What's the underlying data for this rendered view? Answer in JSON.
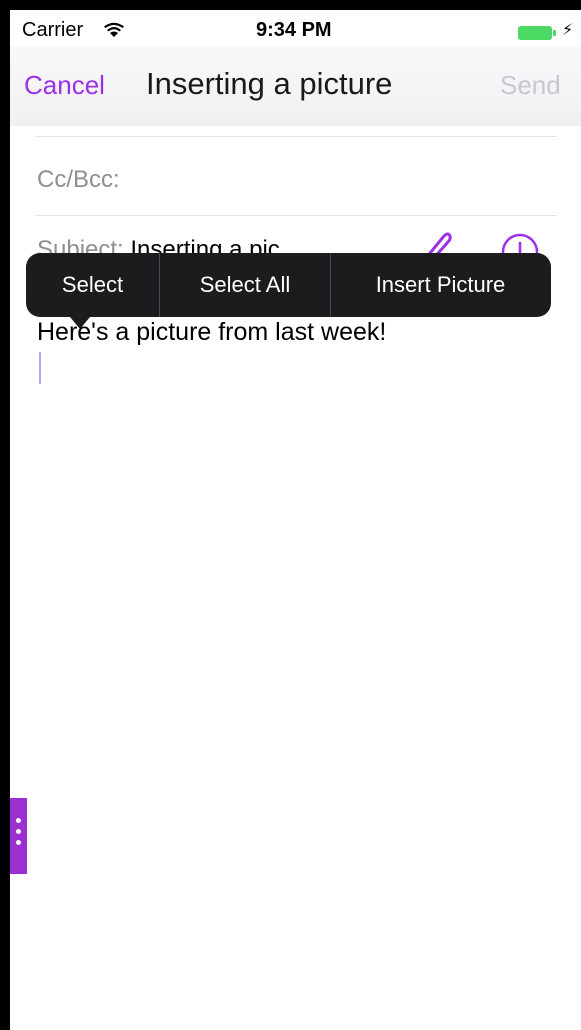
{
  "status_bar": {
    "carrier": "Carrier",
    "time": "9:34 PM",
    "wifi_icon": "wifi-icon",
    "battery_icon": "battery-icon",
    "charging_icon": "charging-bolt-icon"
  },
  "nav": {
    "cancel_label": "Cancel",
    "title": "Inserting a picture",
    "send_label": "Send",
    "accent_color": "#9b30e8",
    "disabled_color": "#c8c8cc"
  },
  "fields": {
    "cc_bcc_label": "Cc/Bcc:",
    "subject_label": "Subject:",
    "subject_value": "Inserting a pic",
    "attach_icon": "paperclip-icon",
    "add_icon": "plus-circle-icon"
  },
  "context_menu": {
    "items": [
      "Select",
      "Select All",
      "Insert Picture"
    ]
  },
  "message": {
    "body": "Here's a picture from last week!"
  },
  "side_handle": {
    "icon": "more-vertical-icon",
    "color": "#9b30d0"
  }
}
